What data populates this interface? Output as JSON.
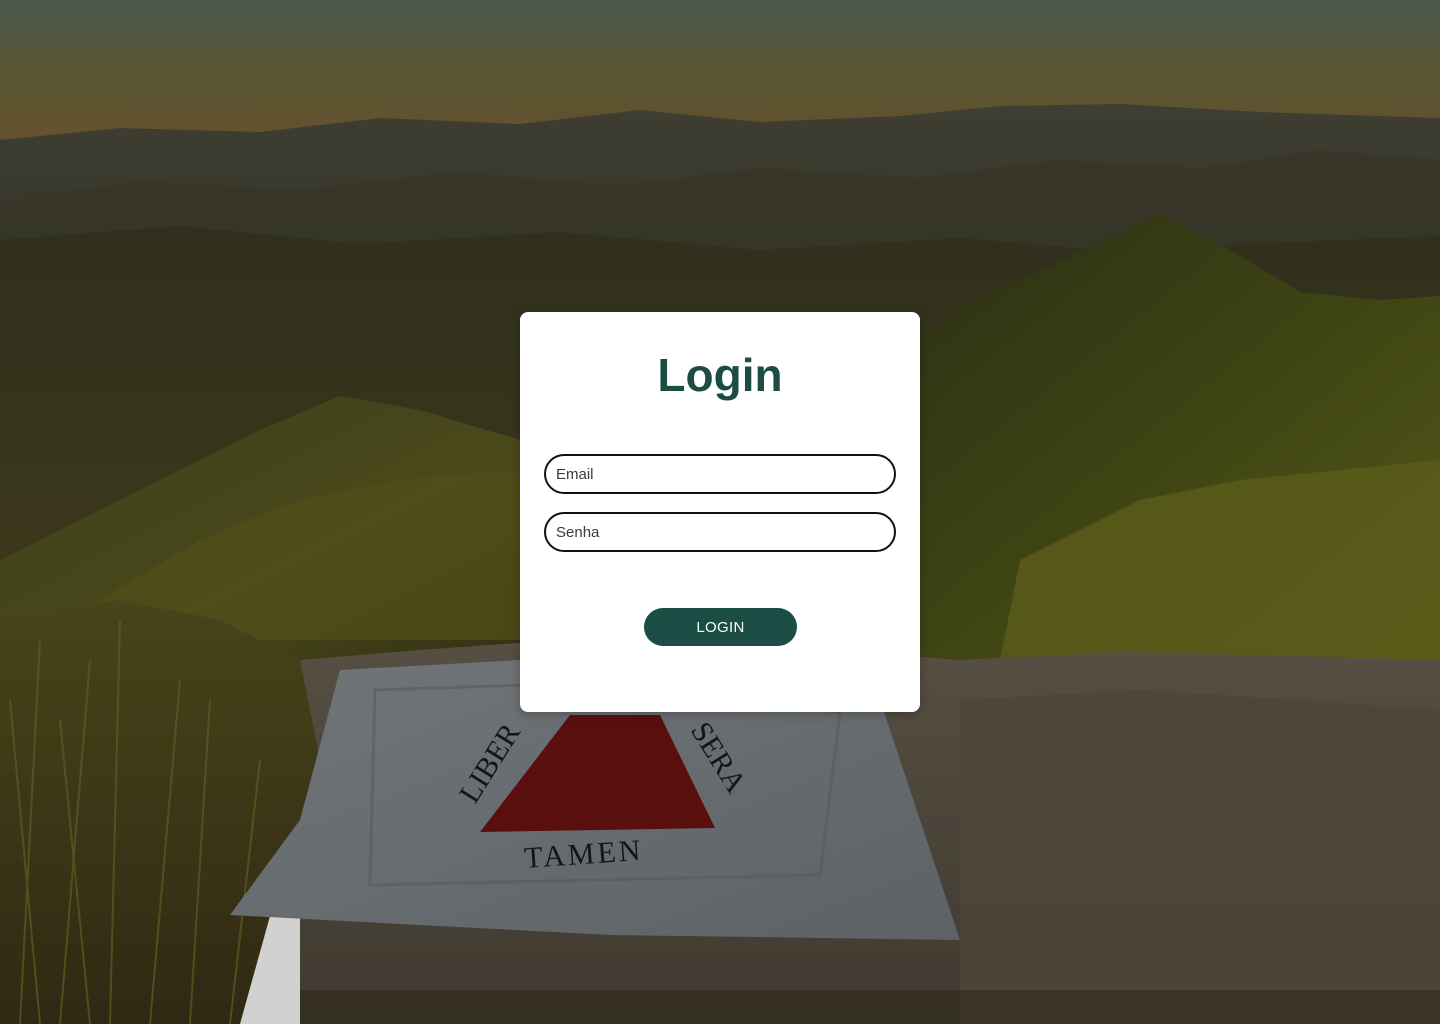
{
  "login": {
    "title": "Login",
    "email_placeholder": "Email",
    "password_placeholder": "Senha",
    "submit_label": "LOGIN"
  },
  "background": {
    "flag_text": {
      "left": "LIBER",
      "right": "SERA",
      "bottom": "TAMEN"
    }
  },
  "colors": {
    "accent": "#1c4d44",
    "card": "#ffffff",
    "input_border": "#111111",
    "flag_triangle": "#b01010"
  }
}
